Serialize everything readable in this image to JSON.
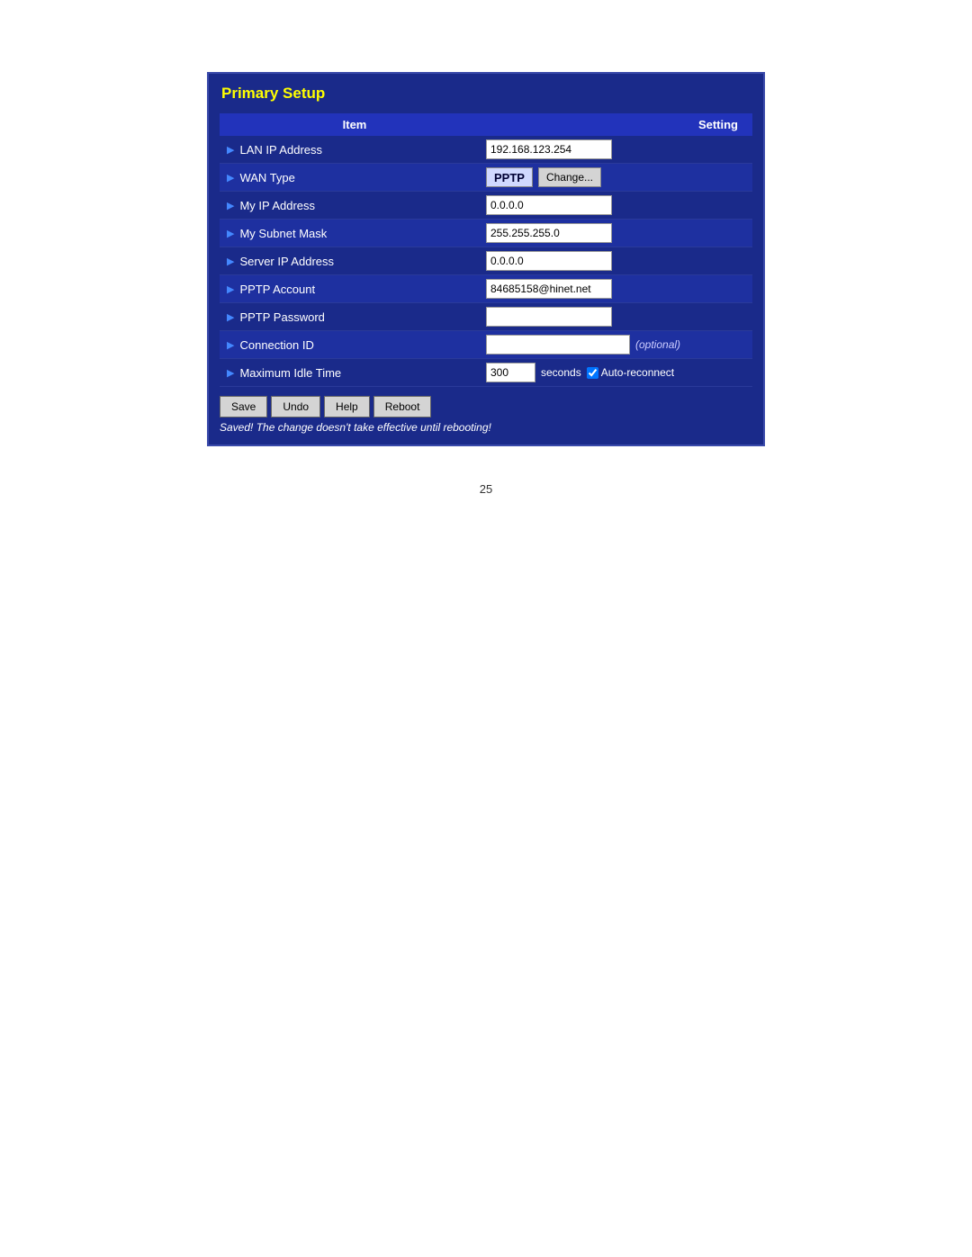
{
  "panel": {
    "title": "Primary Setup",
    "header": {
      "col_item": "Item",
      "col_setting": "Setting"
    },
    "rows": [
      {
        "id": "lan-ip",
        "label": "LAN IP Address",
        "arrow": "▶",
        "type": "input",
        "value": "192.168.123.254"
      },
      {
        "id": "wan-type",
        "label": "WAN Type",
        "arrow": "▶",
        "type": "wan",
        "wan_value": "PPTP",
        "change_label": "Change..."
      },
      {
        "id": "my-ip",
        "label": "My IP Address",
        "arrow": "▶",
        "type": "input",
        "value": "0.0.0.0"
      },
      {
        "id": "my-subnet",
        "label": "My Subnet Mask",
        "arrow": "▶",
        "type": "input",
        "value": "255.255.255.0"
      },
      {
        "id": "server-ip",
        "label": "Server IP Address",
        "arrow": "▶",
        "type": "input",
        "value": "0.0.0.0"
      },
      {
        "id": "pptp-account",
        "label": "PPTP Account",
        "arrow": "▶",
        "type": "input",
        "value": "84685158@hinet.net"
      },
      {
        "id": "pptp-password",
        "label": "PPTP Password",
        "arrow": "▶",
        "type": "input",
        "value": ""
      },
      {
        "id": "connection-id",
        "label": "Connection ID",
        "arrow": "▶",
        "type": "input-optional",
        "value": "",
        "optional_text": "(optional)"
      },
      {
        "id": "max-idle",
        "label": "Maximum Idle Time",
        "arrow": "▶",
        "type": "idle",
        "value": "300",
        "seconds_label": "seconds",
        "auto_reconnect_label": "Auto-reconnect",
        "checked": true
      }
    ],
    "buttons": {
      "save": "Save",
      "undo": "Undo",
      "help": "Help",
      "reboot": "Reboot"
    },
    "status_message": "Saved! The change doesn't take effective until rebooting!"
  },
  "page_number": "25"
}
